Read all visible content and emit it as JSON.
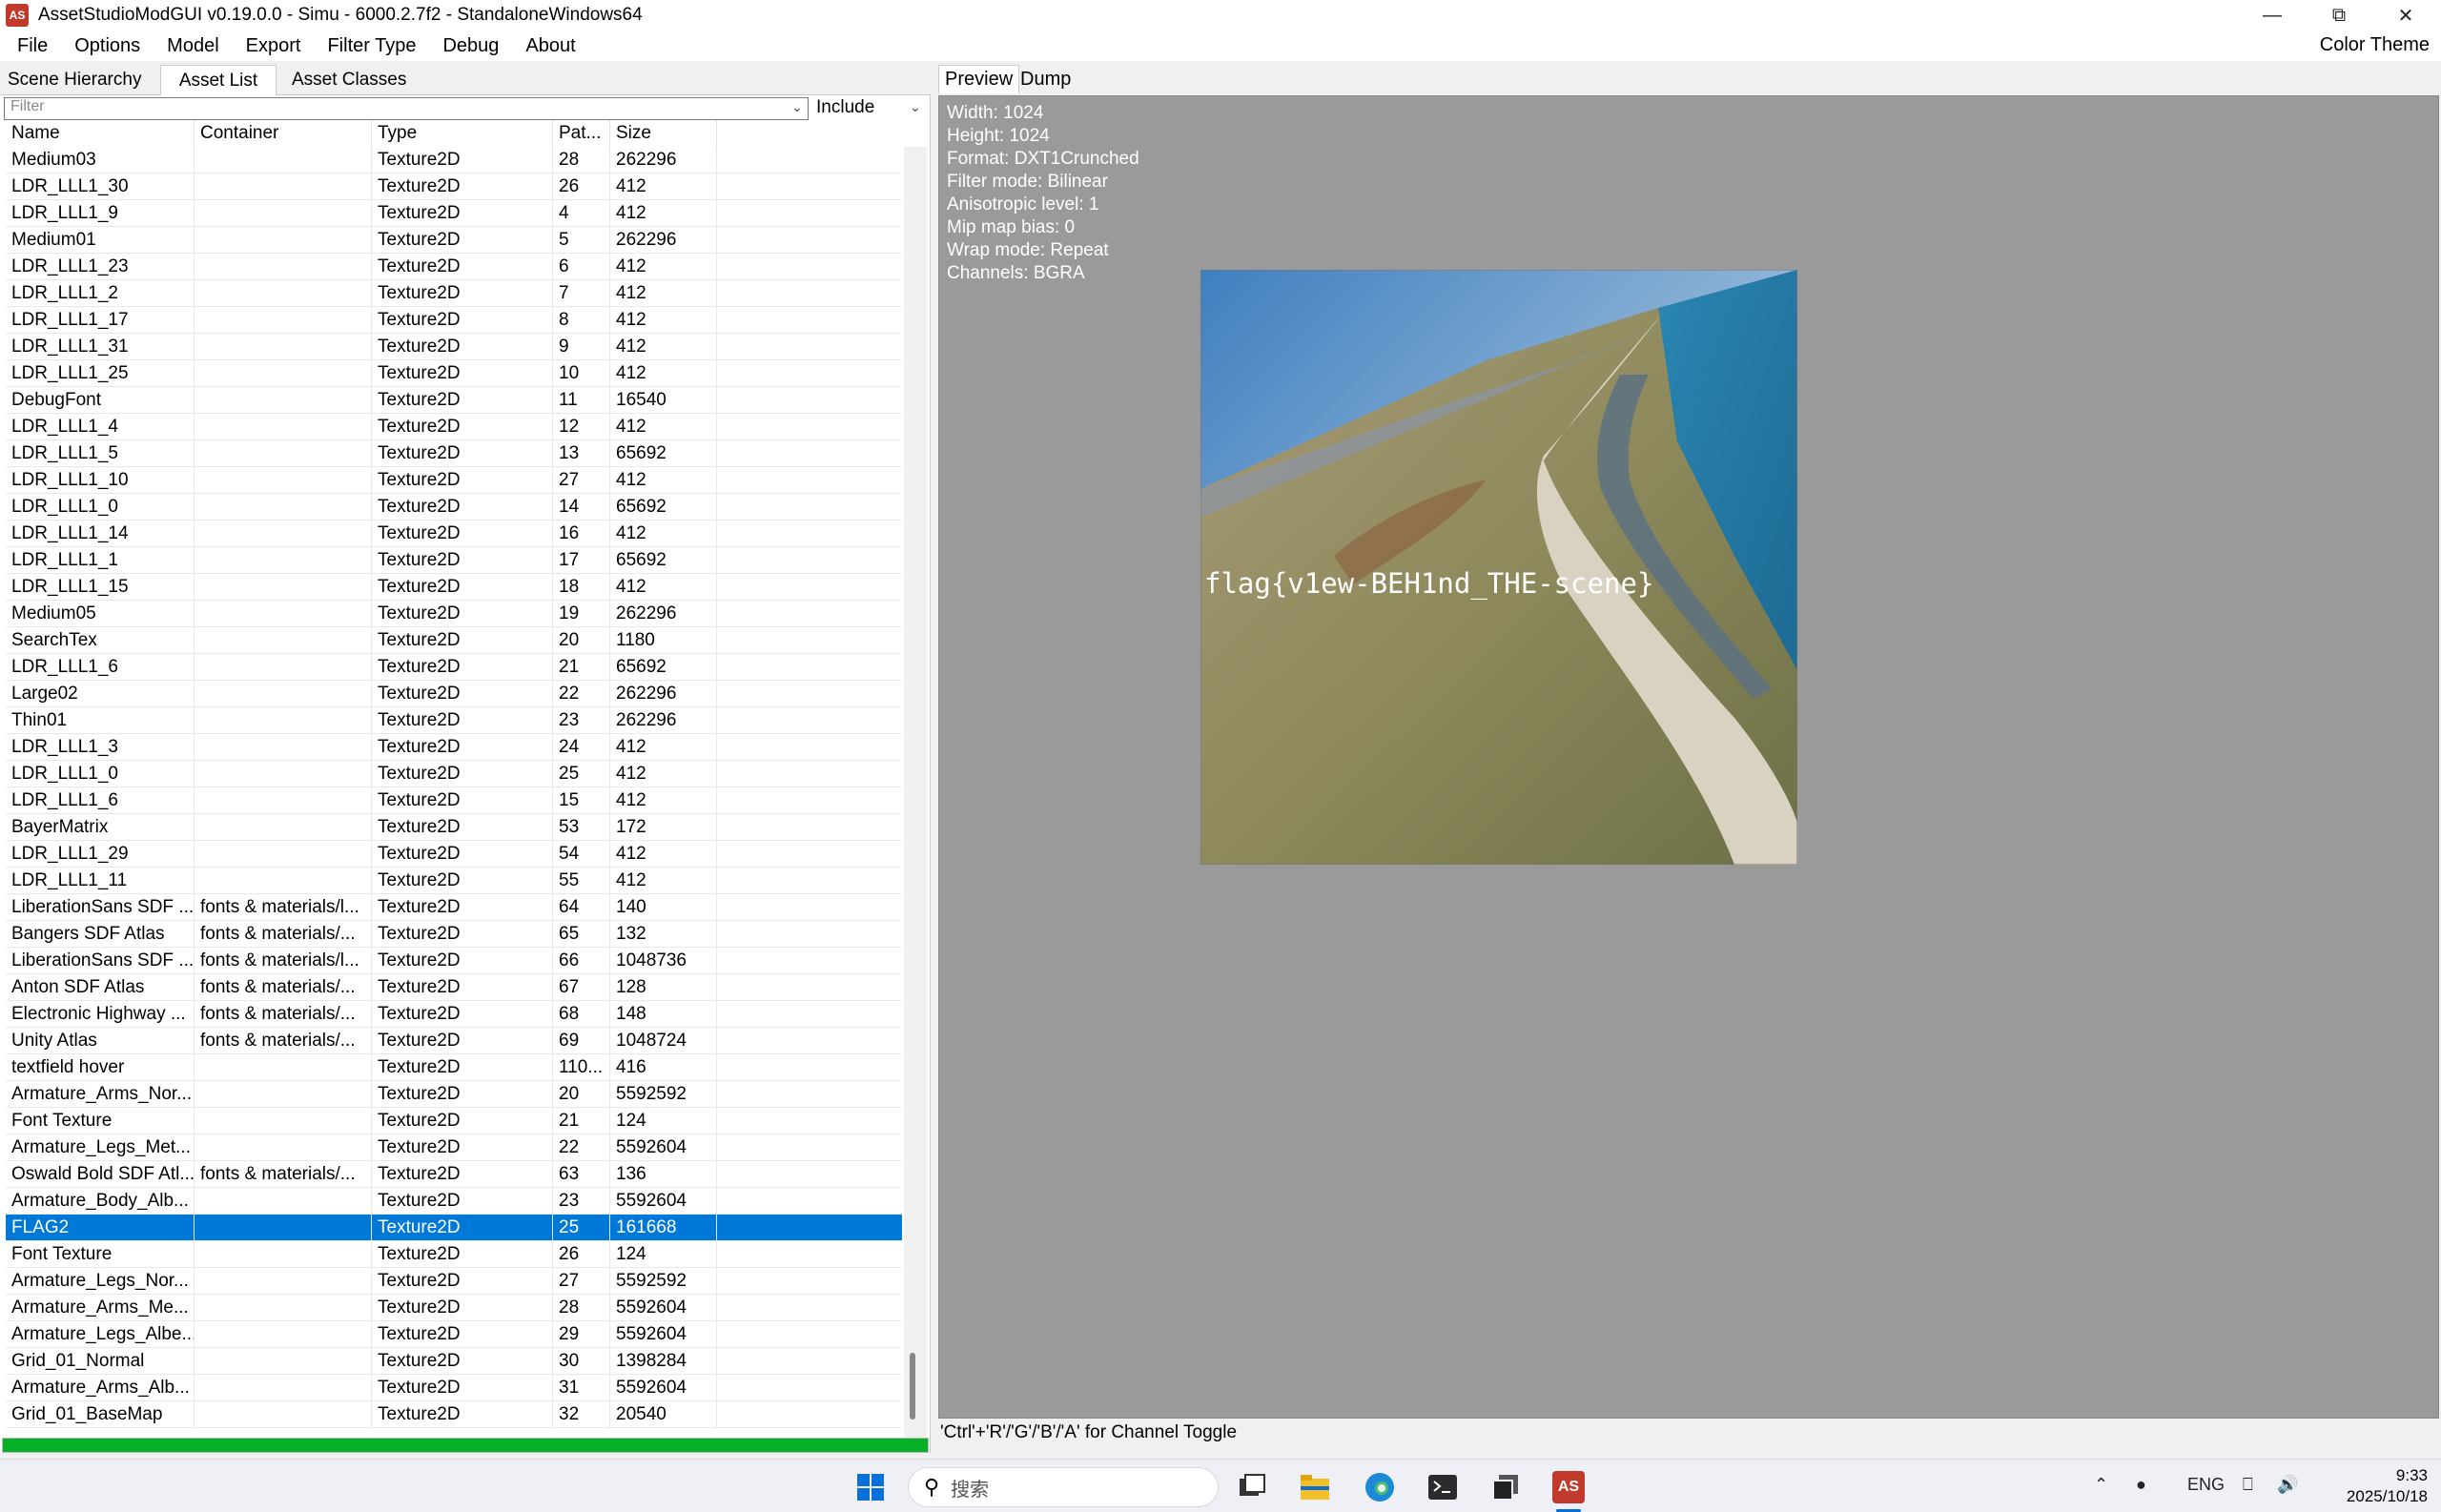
{
  "window": {
    "title": "AssetStudioModGUI v0.19.0.0 - Simu - 6000.2.7f2 - StandaloneWindows64",
    "app_icon_text": "AS",
    "minimize": "—",
    "restore": "⧉",
    "close": "✕"
  },
  "menu": {
    "items": [
      "File",
      "Options",
      "Model",
      "Export",
      "Filter Type",
      "Debug",
      "About"
    ],
    "color_theme": "Color Theme"
  },
  "left_tabs": [
    "Scene Hierarchy",
    "Asset List",
    "Asset Classes"
  ],
  "filter": {
    "placeholder": "Filter",
    "mode": "Include"
  },
  "columns": [
    "Name",
    "Container",
    "Type",
    "Pat...",
    "Size"
  ],
  "rows": [
    [
      "Medium03",
      "",
      "Texture2D",
      "28",
      "262296"
    ],
    [
      "LDR_LLL1_30",
      "",
      "Texture2D",
      "26",
      "412"
    ],
    [
      "LDR_LLL1_9",
      "",
      "Texture2D",
      "4",
      "412"
    ],
    [
      "Medium01",
      "",
      "Texture2D",
      "5",
      "262296"
    ],
    [
      "LDR_LLL1_23",
      "",
      "Texture2D",
      "6",
      "412"
    ],
    [
      "LDR_LLL1_2",
      "",
      "Texture2D",
      "7",
      "412"
    ],
    [
      "LDR_LLL1_17",
      "",
      "Texture2D",
      "8",
      "412"
    ],
    [
      "LDR_LLL1_31",
      "",
      "Texture2D",
      "9",
      "412"
    ],
    [
      "LDR_LLL1_25",
      "",
      "Texture2D",
      "10",
      "412"
    ],
    [
      "DebugFont",
      "",
      "Texture2D",
      "11",
      "16540"
    ],
    [
      "LDR_LLL1_4",
      "",
      "Texture2D",
      "12",
      "412"
    ],
    [
      "LDR_LLL1_5",
      "",
      "Texture2D",
      "13",
      "65692"
    ],
    [
      "LDR_LLL1_10",
      "",
      "Texture2D",
      "27",
      "412"
    ],
    [
      "LDR_LLL1_0",
      "",
      "Texture2D",
      "14",
      "65692"
    ],
    [
      "LDR_LLL1_14",
      "",
      "Texture2D",
      "16",
      "412"
    ],
    [
      "LDR_LLL1_1",
      "",
      "Texture2D",
      "17",
      "65692"
    ],
    [
      "LDR_LLL1_15",
      "",
      "Texture2D",
      "18",
      "412"
    ],
    [
      "Medium05",
      "",
      "Texture2D",
      "19",
      "262296"
    ],
    [
      "SearchTex",
      "",
      "Texture2D",
      "20",
      "1180"
    ],
    [
      "LDR_LLL1_6",
      "",
      "Texture2D",
      "21",
      "65692"
    ],
    [
      "Large02",
      "",
      "Texture2D",
      "22",
      "262296"
    ],
    [
      "Thin01",
      "",
      "Texture2D",
      "23",
      "262296"
    ],
    [
      "LDR_LLL1_3",
      "",
      "Texture2D",
      "24",
      "412"
    ],
    [
      "LDR_LLL1_0",
      "",
      "Texture2D",
      "25",
      "412"
    ],
    [
      "LDR_LLL1_6",
      "",
      "Texture2D",
      "15",
      "412"
    ],
    [
      "BayerMatrix",
      "",
      "Texture2D",
      "53",
      "172"
    ],
    [
      "LDR_LLL1_29",
      "",
      "Texture2D",
      "54",
      "412"
    ],
    [
      "LDR_LLL1_11",
      "",
      "Texture2D",
      "55",
      "412"
    ],
    [
      "LiberationSans SDF ...",
      "fonts & materials/l...",
      "Texture2D",
      "64",
      "140"
    ],
    [
      "Bangers SDF Atlas",
      "fonts & materials/...",
      "Texture2D",
      "65",
      "132"
    ],
    [
      "LiberationSans SDF ...",
      "fonts & materials/l...",
      "Texture2D",
      "66",
      "1048736"
    ],
    [
      "Anton SDF Atlas",
      "fonts & materials/...",
      "Texture2D",
      "67",
      "128"
    ],
    [
      "Electronic Highway ...",
      "fonts & materials/...",
      "Texture2D",
      "68",
      "148"
    ],
    [
      "Unity Atlas",
      "fonts & materials/...",
      "Texture2D",
      "69",
      "1048724"
    ],
    [
      "textfield hover",
      "",
      "Texture2D",
      "110...",
      "416"
    ],
    [
      "Armature_Arms_Nor...",
      "",
      "Texture2D",
      "20",
      "5592592"
    ],
    [
      "Font Texture",
      "",
      "Texture2D",
      "21",
      "124"
    ],
    [
      "Armature_Legs_Met...",
      "",
      "Texture2D",
      "22",
      "5592604"
    ],
    [
      "Oswald Bold SDF Atl...",
      "fonts & materials/...",
      "Texture2D",
      "63",
      "136"
    ],
    [
      "Armature_Body_Alb...",
      "",
      "Texture2D",
      "23",
      "5592604"
    ],
    [
      "FLAG2",
      "",
      "Texture2D",
      "25",
      "161668"
    ],
    [
      "Font Texture",
      "",
      "Texture2D",
      "26",
      "124"
    ],
    [
      "Armature_Legs_Nor...",
      "",
      "Texture2D",
      "27",
      "5592592"
    ],
    [
      "Armature_Arms_Me...",
      "",
      "Texture2D",
      "28",
      "5592604"
    ],
    [
      "Armature_Legs_Albe...",
      "",
      "Texture2D",
      "29",
      "5592604"
    ],
    [
      "Grid_01_Normal",
      "",
      "Texture2D",
      "30",
      "1398284"
    ],
    [
      "Armature_Arms_Alb...",
      "",
      "Texture2D",
      "31",
      "5592604"
    ],
    [
      "Grid_01_BaseMap",
      "",
      "Texture2D",
      "32",
      "20540"
    ]
  ],
  "selected_row": 40,
  "right_tabs": [
    "Preview",
    "Dump"
  ],
  "info_lines": [
    "Width: 1024",
    "Height: 1024",
    "Format: DXT1Crunched",
    "Filter mode: Bilinear",
    "Anisotropic level: 1",
    "Mip map bias: 0",
    "Wrap mode: Repeat",
    "Channels: BGRA"
  ],
  "texture_text": "flag{v1ew-BEH1nd_THE-scene}",
  "status_text": "'Ctrl'+'R'/'G'/'B'/'A' for Channel Toggle",
  "progress": 1.0,
  "taskbar": {
    "search_placeholder": "搜索",
    "lang": "ENG",
    "time": "9:33",
    "date": "2025/10/18"
  },
  "colors": {
    "selection": "#0078d7",
    "progress": "#06b025",
    "preview_bg": "#9a9a9a"
  }
}
